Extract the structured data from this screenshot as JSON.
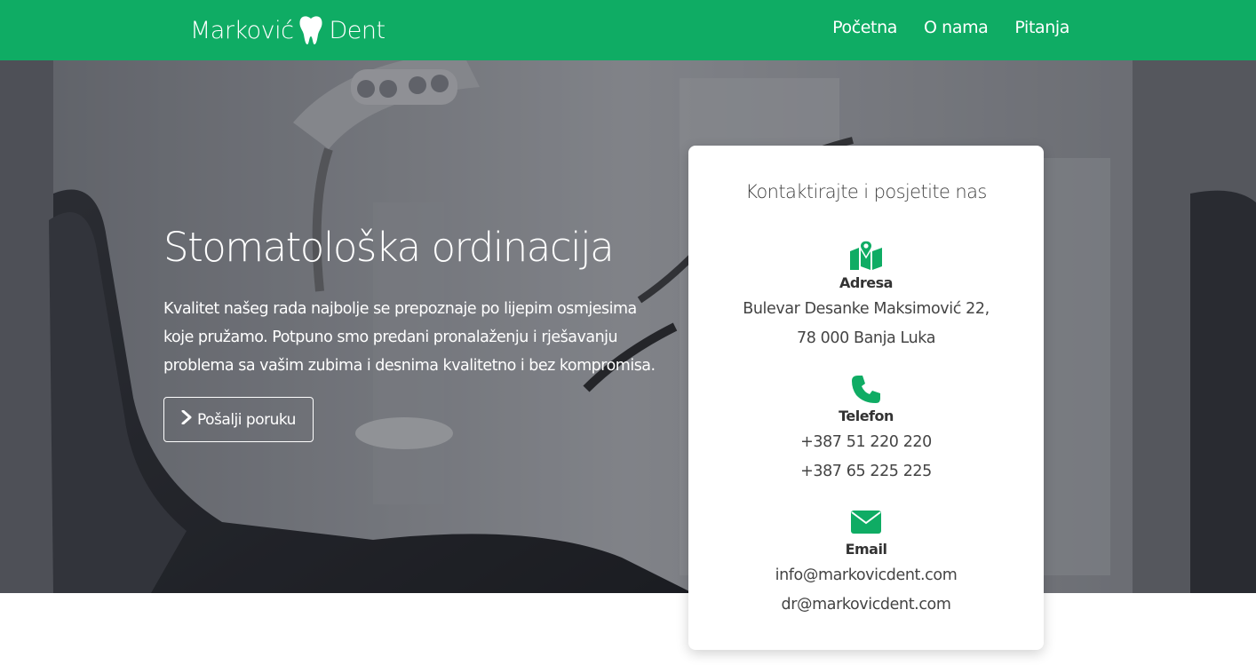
{
  "navbar": {
    "brand_left": "Marković",
    "brand_right": "Dent",
    "brand_icon": "tooth-icon",
    "links": [
      "Početna",
      "O nama",
      "Pitanja"
    ],
    "color": "#0fac64"
  },
  "hero": {
    "title": "Stomatološka ordinacija",
    "text": "Kvalitet našeg rada najbolje se prepoznaje po lijepim osmjesima koje pružamo. Potpuno smo predani pronalaženju i rješavanju problema sa vašim zubima i desnima kvalitetno i bez kompromisa.",
    "button_label": "Pošalji poruku",
    "button_icon": "chevron-right-icon"
  },
  "contact": {
    "title": "Kontaktirajte i posjetite nas",
    "address": {
      "icon": "map-icon",
      "label": "Adresa",
      "lines": [
        "Bulevar Desanke Maksimović 22,",
        "78 000 Banja Luka"
      ]
    },
    "phone": {
      "icon": "phone-icon",
      "label": "Telefon",
      "lines": [
        "+387 51 220 220",
        "+387 65 225 225"
      ]
    },
    "email": {
      "icon": "envelope-icon",
      "label": "Email",
      "lines": [
        "info@markovicdent.com",
        "dr@markovicdent.com"
      ]
    },
    "accent": "#0fac64"
  }
}
